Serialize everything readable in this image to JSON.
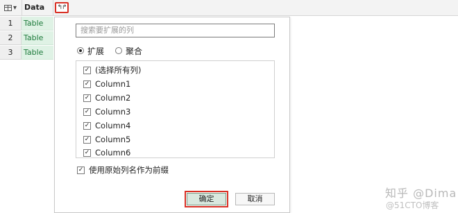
{
  "grid": {
    "column_header": "Data",
    "expand_button_glyph": "↰↱",
    "rows": [
      {
        "num": "1",
        "value": "Table"
      },
      {
        "num": "2",
        "value": "Table"
      },
      {
        "num": "3",
        "value": "Table"
      }
    ]
  },
  "dialog": {
    "search_placeholder": "搜索要扩展的列",
    "modes": [
      {
        "label": "扩展",
        "selected": true
      },
      {
        "label": "聚合",
        "selected": false
      }
    ],
    "columns": [
      {
        "label": "(选择所有列)",
        "checked": true
      },
      {
        "label": "Column1",
        "checked": true
      },
      {
        "label": "Column2",
        "checked": true
      },
      {
        "label": "Column3",
        "checked": true
      },
      {
        "label": "Column4",
        "checked": true
      },
      {
        "label": "Column5",
        "checked": true
      },
      {
        "label": "Column6",
        "checked": true
      }
    ],
    "prefix_option": {
      "label": "使用原始列名作为前缀",
      "checked": true
    },
    "ok_label": "确定",
    "cancel_label": "取消",
    "check_glyph": "✓"
  },
  "watermark": {
    "line1": "知乎 @Dima",
    "line2": "@51CTO博客"
  },
  "colors": {
    "cell_bg": "#dff2e5",
    "cell_text": "#1e7b3c",
    "highlight": "#d93025"
  }
}
